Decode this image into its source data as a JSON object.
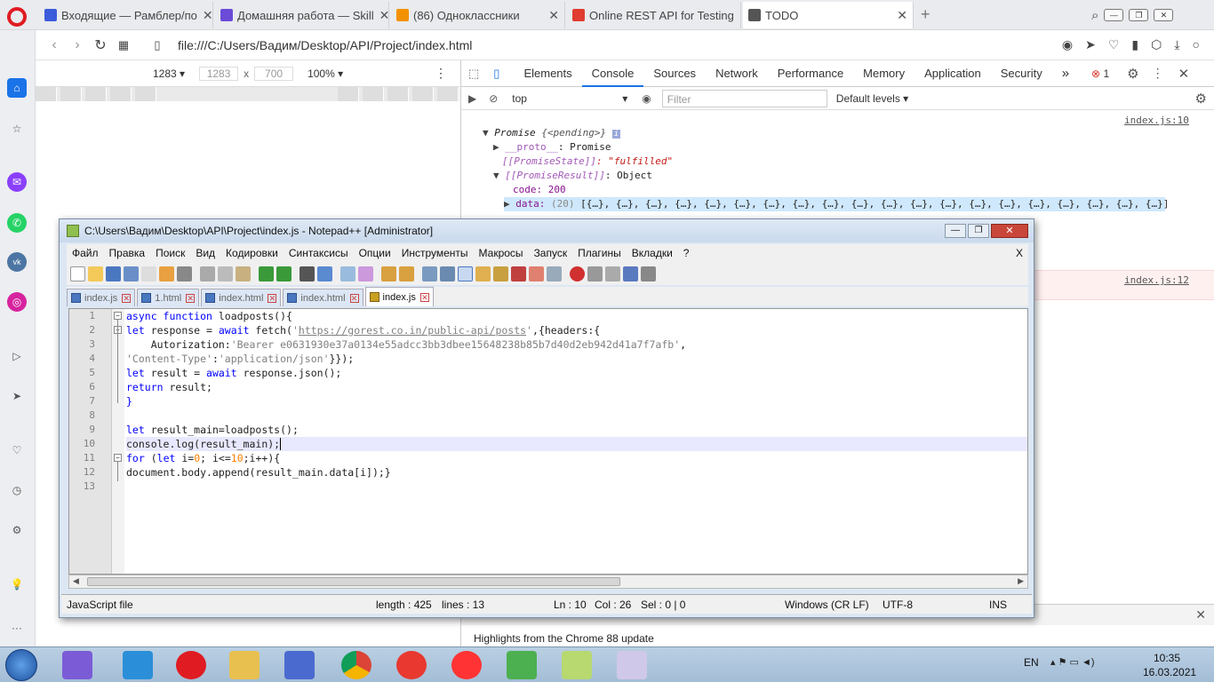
{
  "browser": {
    "tabs": [
      {
        "title": "Входящие — Рамблер/пo",
        "color": "#3b5bdb"
      },
      {
        "title": "Домашняя работа — Skill",
        "color": "#6c4bd8"
      },
      {
        "title": "(86) Одноклассники",
        "color": "#f39200"
      },
      {
        "title": "Online REST API for Testing",
        "color": "#e03c31"
      },
      {
        "title": "TODO",
        "color": "#555555"
      }
    ],
    "url": "file:///C:/Users/Вадим/Desktop/API/Project/index.html"
  },
  "device_toolbar": {
    "dimension_preset": "1283",
    "width": "1283",
    "times": "x",
    "height": "700",
    "zoom": "100%"
  },
  "devtools": {
    "tabs": [
      "Elements",
      "Console",
      "Sources",
      "Network",
      "Performance",
      "Memory",
      "Application",
      "Security"
    ],
    "more": "»",
    "error_count": "1",
    "context": "top",
    "filter_placeholder": "Filter",
    "levels": "Default levels",
    "drawer_text": "Highlights from the Chrome 88 update"
  },
  "console": {
    "link1": "index.js:10",
    "promise_label": "Promise",
    "pending": "{<pending>}",
    "proto_key": "__proto__",
    "proto_val": ": Promise",
    "state_key": "[[PromiseState]]",
    "state_val": ": \"fulfilled\"",
    "result_key": "[[PromiseResult]]",
    "result_val": ": Object",
    "code_line": "code: 200",
    "data_key": "data:",
    "data_count": "(20)",
    "data_items": "[{…}, {…}, {…}, {…}, {…}, {…}, {…}, {…}, {…}, {…}, {…}, {…}, {…}, {…}, {…}, {…}, {…}, {…}, {…}, {…}]",
    "link2": "index.js:12"
  },
  "notepad": {
    "title": "C:\\Users\\Вадим\\Desktop\\API\\Project\\index.js - Notepad++ [Administrator]",
    "menu": [
      "Файл",
      "Правка",
      "Поиск",
      "Вид",
      "Кодировки",
      "Синтаксисы",
      "Опции",
      "Инструменты",
      "Макросы",
      "Запуск",
      "Плагины",
      "Вкладки",
      "?"
    ],
    "menu_close": "X",
    "tabs": [
      "index.js",
      "1.html",
      "index.html",
      "index.html",
      "index.js"
    ],
    "line_numbers": [
      "1",
      "2",
      "3",
      "4",
      "5",
      "6",
      "7",
      "8",
      "9",
      "10",
      "11",
      "12",
      "13"
    ],
    "code": {
      "l1a": "async function",
      "l1b": " loadposts(){",
      "l2a": "let",
      "l2b": " response = ",
      "l2c": "await",
      "l2d": " fetch(",
      "l2e": "'",
      "l2f": "https://gorest.co.in/public-api/posts",
      "l2g": "'",
      "l2h": ",{headers:{",
      "l3a": "    Autorization:",
      "l3b": "'Bearer e0631930e37a0134e55adcc3bb3dbee15648238b85b7d40d2eb942d41a7f7afb'",
      "l3c": ",",
      "l4a": "'Content-Type'",
      "l4b": ":",
      "l4c": "'application/json'",
      "l4d": "}});",
      "l5a": "let",
      "l5b": " result = ",
      "l5c": "await",
      "l5d": " response.json();",
      "l6a": "return",
      "l6b": " result;",
      "l7": "}",
      "l9a": "let",
      "l9b": " result_main=loadposts();",
      "l10": "console.log(result_main);",
      "l11a": "for",
      "l11b": " (",
      "l11c": "let",
      "l11d": " i=",
      "l11e": "0",
      "l11f": "; i<=",
      "l11g": "10",
      "l11h": ";i++){",
      "l12": "document.body.append(result_main.data[i]);}"
    },
    "status": {
      "type": "JavaScript file",
      "length": "length : 425",
      "lines": "lines : 13",
      "ln": "Ln : 10",
      "col": "Col : 26",
      "sel": "Sel : 0 | 0",
      "eol": "Windows (CR LF)",
      "enc": "UTF-8",
      "mode": "INS"
    }
  },
  "taskbar": {
    "lang": "EN",
    "time": "10:35",
    "date": "16.03.2021"
  }
}
